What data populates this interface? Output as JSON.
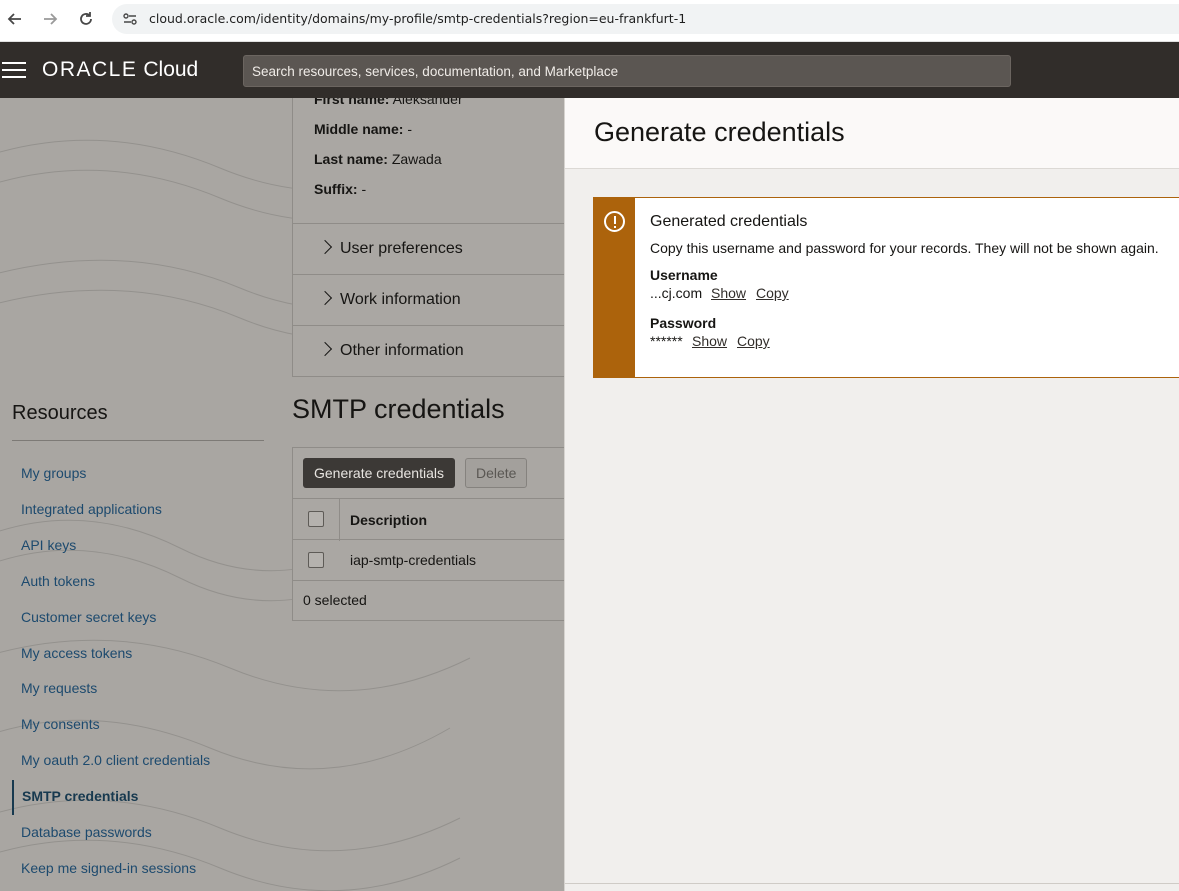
{
  "browser": {
    "url": "cloud.oracle.com/identity/domains/my-profile/smtp-credentials?region=eu-frankfurt-1"
  },
  "header": {
    "logo_oracle": "ORACLE",
    "logo_cloud": "Cloud",
    "search_placeholder": "Search resources, services, documentation, and Marketplace"
  },
  "profile": {
    "first_name_label": "First name:",
    "first_name": "Aleksander",
    "middle_name_label": "Middle name:",
    "middle_name": "-",
    "last_name_label": "Last name:",
    "last_name": "Zawada",
    "suffix_label": "Suffix:",
    "suffix": "-"
  },
  "sections": [
    {
      "label": "User preferences"
    },
    {
      "label": "Work information"
    },
    {
      "label": "Other information"
    }
  ],
  "resources": {
    "title": "Resources",
    "items": [
      {
        "label": "My groups"
      },
      {
        "label": "Integrated applications"
      },
      {
        "label": "API keys"
      },
      {
        "label": "Auth tokens"
      },
      {
        "label": "Customer secret keys"
      },
      {
        "label": "My access tokens"
      },
      {
        "label": "My requests"
      },
      {
        "label": "My consents"
      },
      {
        "label": "My oauth 2.0 client credentials"
      },
      {
        "label": "SMTP credentials",
        "active": true
      },
      {
        "label": "Database passwords"
      },
      {
        "label": "Keep me signed-in sessions"
      }
    ]
  },
  "smtp": {
    "title": "SMTP credentials",
    "generate_label": "Generate credentials",
    "delete_label": "Delete",
    "column_description": "Description",
    "rows": [
      {
        "description": "iap-smtp-credentials"
      }
    ],
    "selected_count": "0 selected"
  },
  "drawer": {
    "title": "Generate credentials",
    "alert": {
      "title": "Generated credentials",
      "message": "Copy this username and password for your records. They will not be shown again.",
      "username_label": "Username",
      "username_value": "...cj.com",
      "password_label": "Password",
      "password_value": "******",
      "show_label": "Show",
      "copy_label": "Copy"
    }
  },
  "colors": {
    "header_bg": "#312d2a",
    "warning_accent": "#ac630c",
    "link": "#1d4a6e"
  }
}
